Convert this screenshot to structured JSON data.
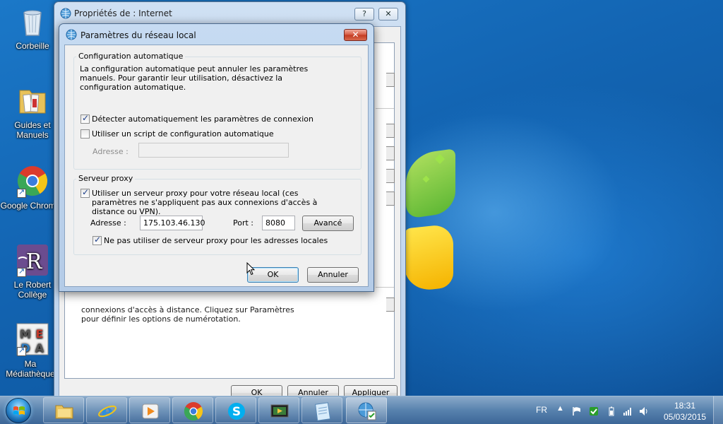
{
  "desktop": {
    "icons": [
      {
        "label": "Corbeille"
      },
      {
        "label": "Guides et\nManuels"
      },
      {
        "label": "Google Chrome"
      },
      {
        "label": "Le Robert\nCollège"
      },
      {
        "label": "Ma\nMédiathèque"
      }
    ]
  },
  "props_window": {
    "title": "Propriétés de : Internet",
    "help_label": "?",
    "close_label": "✕",
    "body_text": "connexions d'accès à distance. Cliquez sur Paramètres pour définir les options de numérotation.",
    "ok_label": "OK",
    "cancel_label": "Annuler",
    "apply_label": "Appliquer"
  },
  "lan_dialog": {
    "title": "Paramètres du réseau local",
    "close_label": "✕",
    "auto_config": {
      "group_label": "Configuration automatique",
      "description": "La configuration automatique peut annuler les paramètres manuels. Pour garantir leur utilisation, désactivez la configuration automatique.",
      "detect_label": "Détecter automatiquement les paramètres de connexion",
      "detect_checked": true,
      "script_label": "Utiliser un script de configuration automatique",
      "script_checked": false,
      "address_label": "Adresse :",
      "address_value": ""
    },
    "proxy": {
      "group_label": "Serveur proxy",
      "use_proxy_label": "Utiliser un serveur proxy pour votre réseau local (ces paramètres ne s'appliquent pas aux connexions d'accès à distance ou VPN).",
      "use_proxy_checked": true,
      "address_label": "Adresse :",
      "address_value": "175.103.46.130",
      "port_label": "Port :",
      "port_value": "8080",
      "advanced_label": "Avancé",
      "bypass_label": "Ne pas utiliser de serveur proxy pour les adresses locales",
      "bypass_checked": true
    },
    "ok_label": "OK",
    "cancel_label": "Annuler"
  },
  "taskbar": {
    "pinned": [
      "windows-explorer-icon",
      "internet-explorer-icon",
      "media-player-icon",
      "chrome-icon",
      "skype-icon",
      "media-center-icon",
      "notepad-icon",
      "internet-options-icon"
    ],
    "language": "FR",
    "time": "18:31",
    "date": "05/03/2015"
  },
  "colors": {
    "accent": "#3c7fb1",
    "desktop_blue": "#1365b3",
    "close_red": "#c23a20"
  }
}
